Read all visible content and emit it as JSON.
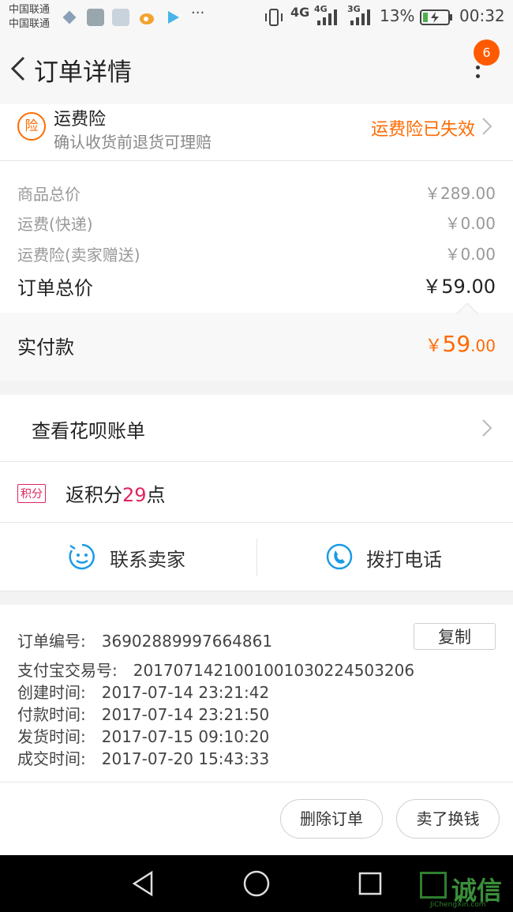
{
  "status_bar": {
    "carrier_1": "中国联通",
    "carrier_2": "中国联通",
    "network_1": "4G",
    "network_2": "4G",
    "network_3": "3G",
    "battery": "13%",
    "time": "00:32",
    "icons": [
      "signal-diamond-icon",
      "gallery-icon",
      "avatar-icon",
      "weibo-icon",
      "play-icon",
      "more-dots-icon",
      "vibrate-icon",
      "battery-charging-icon"
    ]
  },
  "nav": {
    "title": "订单详情",
    "badge_count": "6"
  },
  "insurance": {
    "icon_char": "险",
    "title": "运费险",
    "subtitle": "确认收货前退货可理赔",
    "status": "运费险已失效",
    "status_color": "#ff6a00"
  },
  "price_summary": {
    "rows": [
      {
        "label": "商品总价",
        "value": "￥289.00"
      },
      {
        "label": "运费(快递)",
        "value": "￥0.00"
      },
      {
        "label": "运费险(卖家赠送)",
        "value": "￥0.00"
      }
    ],
    "total_label": "订单总价",
    "total_value": "￥59.00"
  },
  "paid": {
    "label": "实付款",
    "currency": "￥",
    "integer": "59",
    "decimal": ".00",
    "accent": "#ff6a00"
  },
  "huabei": {
    "label": "查看花呗账单"
  },
  "points": {
    "tag": "积分",
    "prefix": "返积分",
    "amount": "29",
    "suffix": "点",
    "accent": "#e0245e"
  },
  "actions": {
    "contact_seller": "联系卖家",
    "call": "拨打电话",
    "icon_color": "#1a9be6"
  },
  "order_info": {
    "order_no_label": "订单编号:",
    "order_no": "36902889997664861",
    "copy_label": "复制",
    "alipay_label": "支付宝交易号:",
    "alipay_no": "2017071421001001030224503206",
    "created_label": "创建时间:",
    "created": "2017-07-14 23:21:42",
    "paid_label": "付款时间:",
    "paid_time": "2017-07-14 23:21:50",
    "shipped_label": "发货时间:",
    "shipped": "2017-07-15 09:10:20",
    "deal_label": "成交时间:",
    "deal": "2017-07-20 15:43:33"
  },
  "bottom_buttons": {
    "delete": "删除订单",
    "resell": "卖了换钱"
  },
  "watermark": {
    "text": "诚信",
    "sub": "JiChengXin.com"
  }
}
